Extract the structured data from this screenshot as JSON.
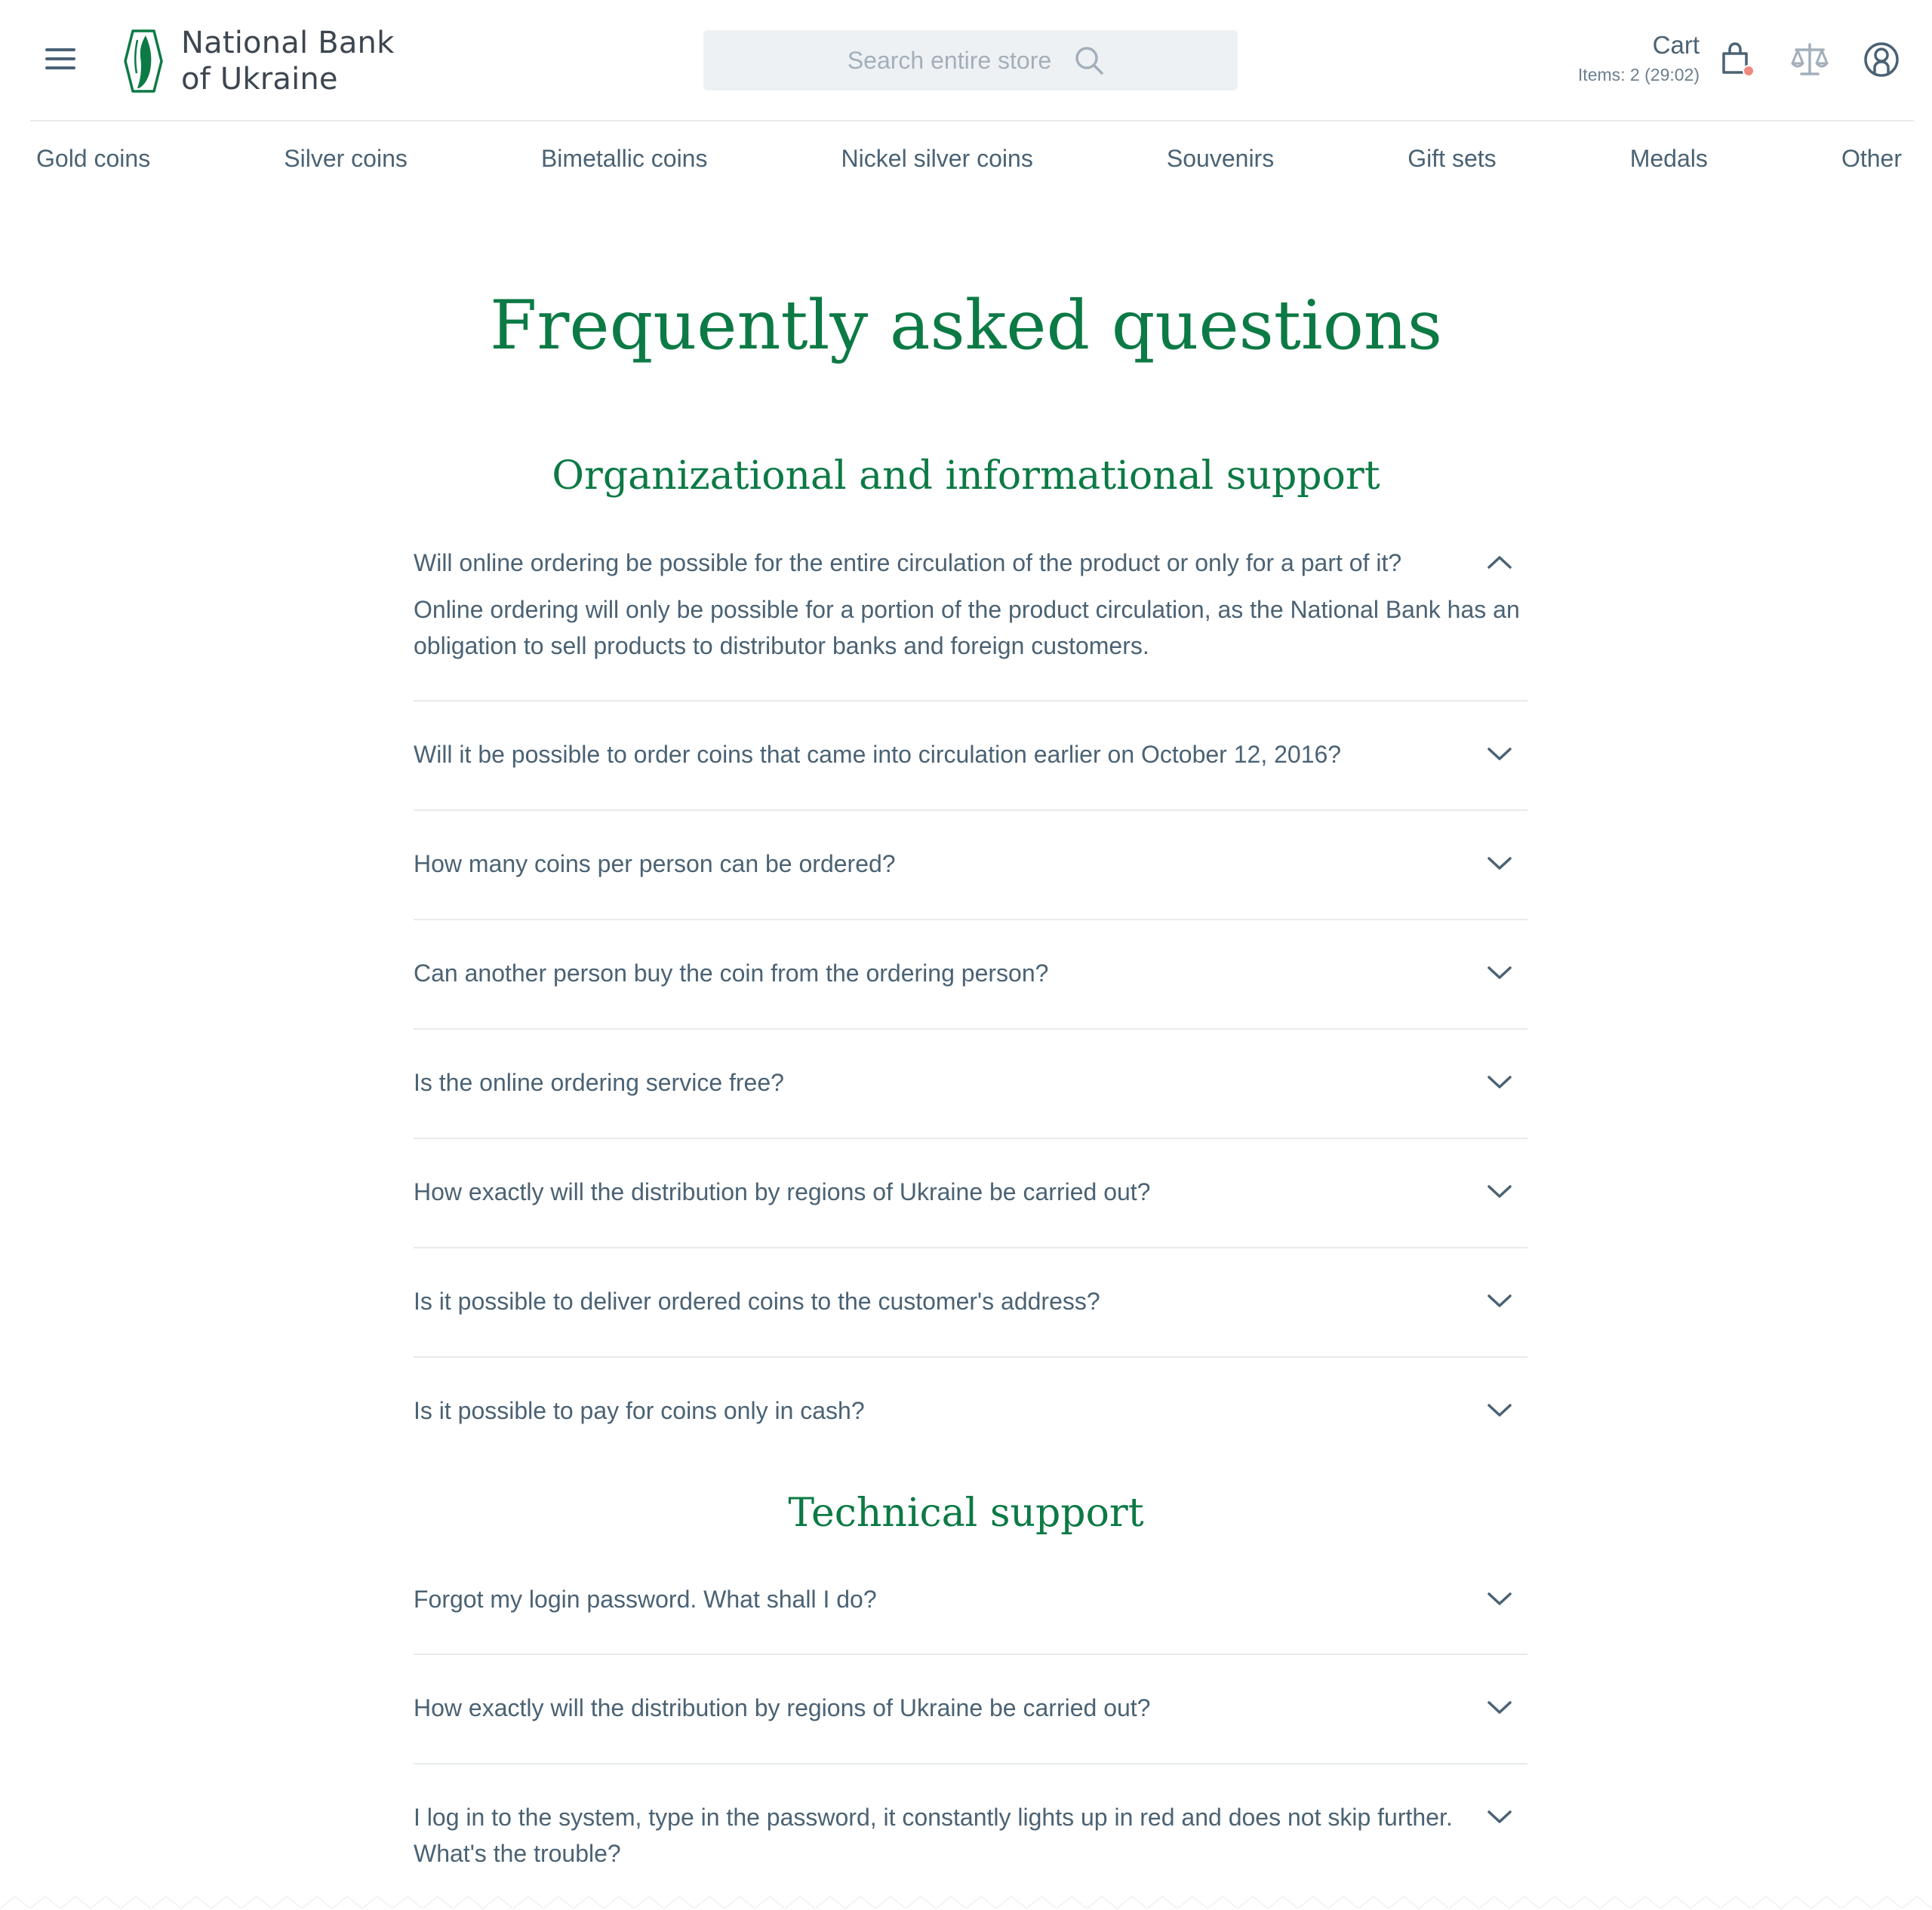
{
  "header": {
    "logo_line1": "National Bank",
    "logo_line2": "of Ukraine",
    "search_placeholder": "Search entire store",
    "cart_title": "Cart",
    "cart_items": "Items: 2 (29:02)"
  },
  "nav": {
    "items": [
      {
        "label": "Gold coins"
      },
      {
        "label": "Silver coins"
      },
      {
        "label": "Bimetallic coins"
      },
      {
        "label": "Nickel silver coins"
      },
      {
        "label": "Souvenirs"
      },
      {
        "label": "Gift sets"
      },
      {
        "label": "Medals"
      },
      {
        "label": "Other"
      }
    ]
  },
  "page": {
    "title": "Frequently asked questions"
  },
  "sections": [
    {
      "title": "Organizational and informational support",
      "items": [
        {
          "question": "Will online ordering be possible for the entire circulation of the product or only for a part of it?",
          "answer": "Online ordering will only be possible for a portion of the product circulation, as the National Bank has an obligation to sell products to distributor banks and foreign customers.",
          "expanded": true
        },
        {
          "question": "Will it be possible to order coins that came into circulation earlier on October 12, 2016?",
          "expanded": false
        },
        {
          "question": "How many coins per person can be ordered?",
          "expanded": false
        },
        {
          "question": "Can another person buy the coin from the ordering person?",
          "expanded": false
        },
        {
          "question": "Is the online ordering service free?",
          "expanded": false
        },
        {
          "question": "How exactly will the distribution by regions of Ukraine be carried out?",
          "expanded": false
        },
        {
          "question": "Is it possible to deliver ordered coins to the customer's address?",
          "expanded": false
        },
        {
          "question": "Is it possible to pay for coins only in cash?",
          "expanded": false
        }
      ]
    },
    {
      "title": "Technical support",
      "items": [
        {
          "question": "Forgot my login password. What shall I do?",
          "expanded": false
        },
        {
          "question": "How exactly will the distribution by regions of Ukraine be carried out?",
          "expanded": false
        },
        {
          "question": "I log in to the system, type in the password, it constantly lights up in red and does not skip further. What's the trouble?",
          "expanded": false
        }
      ]
    }
  ],
  "colors": {
    "brand_green": "#0c7a45",
    "text": "#4a6274",
    "divider": "#e6eaed",
    "search_bg": "#eef1f3",
    "cart_badge": "#f08a7e"
  },
  "icons": {
    "menu": "hamburger-icon",
    "search": "search-icon",
    "cart": "shopping-bag-icon",
    "compare": "scales-icon",
    "account": "user-icon",
    "expand": "chevron-down-icon",
    "collapse": "chevron-up-icon"
  }
}
